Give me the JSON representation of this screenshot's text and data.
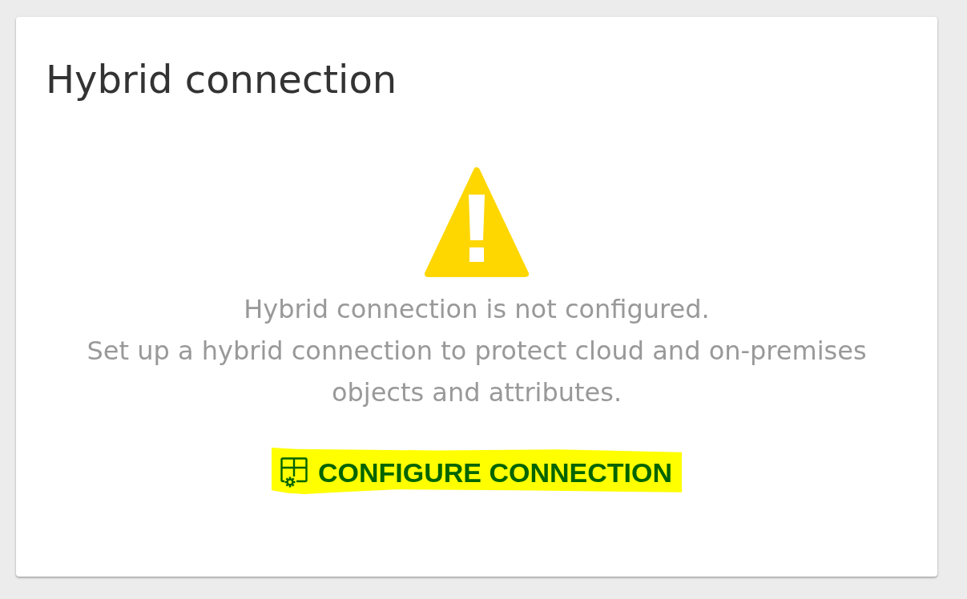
{
  "card": {
    "title": "Hybrid connection"
  },
  "notice": {
    "kind": "warning",
    "message": "Hybrid connection is not configured.",
    "detail": "Set up a hybrid connection to protect cloud and on-premises objects and attributes."
  },
  "action": {
    "label": "CONFIGURE CONNECTION",
    "highlighted": true
  }
}
